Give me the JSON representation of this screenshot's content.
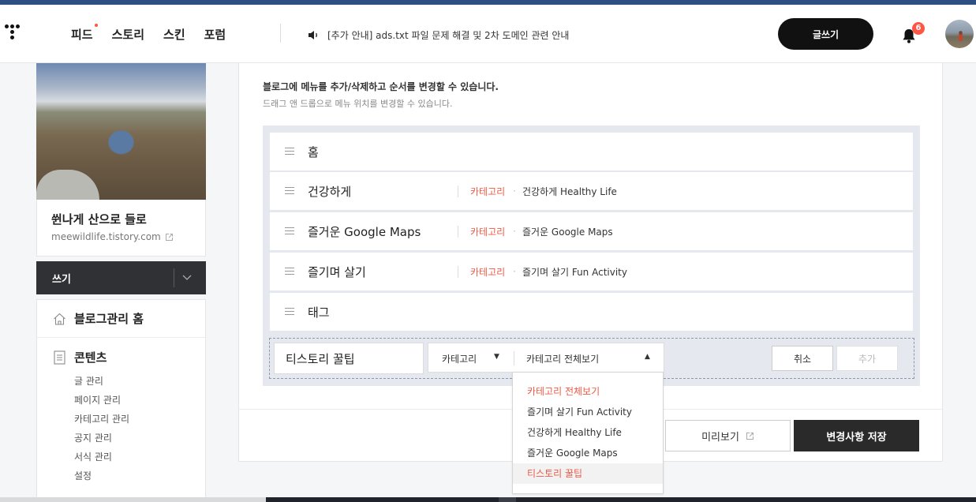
{
  "gnb": {
    "nav": [
      "피드",
      "스토리",
      "스킨",
      "포럼"
    ],
    "notice": "[추가 안내] ads.txt 파일 문제 해결 및 2차 도메인 관련 안내",
    "write_label": "글쓰기",
    "notification_count": "6"
  },
  "sidebar": {
    "blog_name": "쒼나게 산으로 들로",
    "blog_url": "meewildlife.tistory.com",
    "write_label": "쓰기",
    "home_label": "블로그관리 홈",
    "content_title": "콘텐츠",
    "content_items": [
      "글 관리",
      "페이지 관리",
      "카테고리 관리",
      "공지 관리",
      "서식 관리",
      "설정"
    ]
  },
  "main": {
    "desc1": "블로그에 메뉴를 추가/삭제하고 순서를 변경할 수 있습니다.",
    "desc2": "드래그 앤 드롭으로 메뉴 위치를 변경할 수 있습니다.",
    "menus": [
      {
        "title": "홈",
        "type": "",
        "target": ""
      },
      {
        "title": "건강하게",
        "type": "카테고리",
        "target": "건강하게 Healthy Life"
      },
      {
        "title": "즐거운 Google Maps",
        "type": "카테고리",
        "target": "즐거운 Google Maps"
      },
      {
        "title": "즐기며 살기",
        "type": "카테고리",
        "target": "즐기며 살기 Fun Activity"
      },
      {
        "title": "태그",
        "type": "",
        "target": ""
      }
    ],
    "new_menu": {
      "name_value": "티스토리 꿀팁",
      "type_value": "카테고리",
      "target_value": "카테고리 전체보기"
    },
    "cancel_label": "취소",
    "add_label": "추가",
    "preview_label": "미리보기",
    "save_label": "변경사항 저장"
  },
  "dropdown": {
    "options": [
      "카테고리 전체보기",
      "즐기며 살기 Fun Activity",
      "건강하게 Healthy Life",
      "즐거운 Google Maps",
      "티스토리 꿀팁"
    ]
  },
  "colors": {
    "accent": "#ef5a47",
    "topstrip": "#2d4f82",
    "dark_button": "#2a2a2a"
  }
}
